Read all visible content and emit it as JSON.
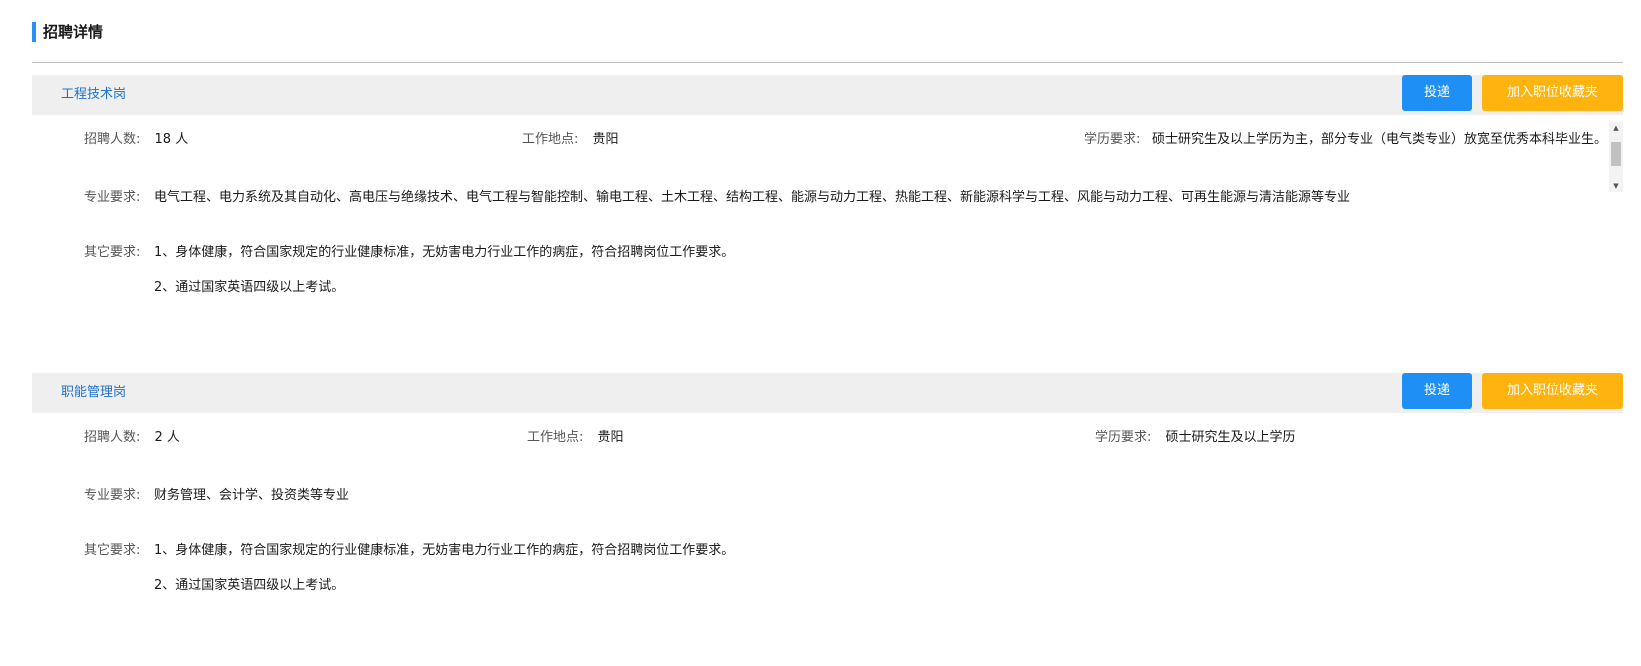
{
  "page": {
    "section_title": "招聘详情"
  },
  "labels": {
    "count": "招聘人数:",
    "location": "工作地点:",
    "education": "学历要求:",
    "major": "专业要求:",
    "other": "其它要求:"
  },
  "buttons": {
    "apply": "投递",
    "favorite": "加入职位收藏夹"
  },
  "jobs": [
    {
      "title": "工程技术岗",
      "count": "18 人",
      "location": "贵阳",
      "education": "硕士研究生及以上学历为主，部分专业（电气类专业）放宽至优秀本科毕业生。",
      "major": "电气工程、电力系统及其自动化、高电压与绝缘技术、电气工程与智能控制、输电工程、土木工程、结构工程、能源与动力工程、热能工程、新能源科学与工程、风能与动力工程、可再生能源与清洁能源等专业",
      "other": [
        "1、身体健康，符合国家规定的行业健康标准，无妨害电力行业工作的病症，符合招聘岗位工作要求。",
        "2、通过国家英语四级以上考试。"
      ]
    },
    {
      "title": "职能管理岗",
      "count": "2 人",
      "location": "贵阳",
      "education": "硕士研究生及以上学历",
      "major": "财务管理、会计学、投资类等专业",
      "other": [
        "1、身体健康，符合国家规定的行业健康标准，无妨害电力行业工作的病症，符合招聘岗位工作要求。",
        "2、通过国家英语四级以上考试。"
      ]
    }
  ],
  "icons": {
    "scroll_up": "triangle-up-icon",
    "scroll_down": "triangle-down-icon"
  }
}
